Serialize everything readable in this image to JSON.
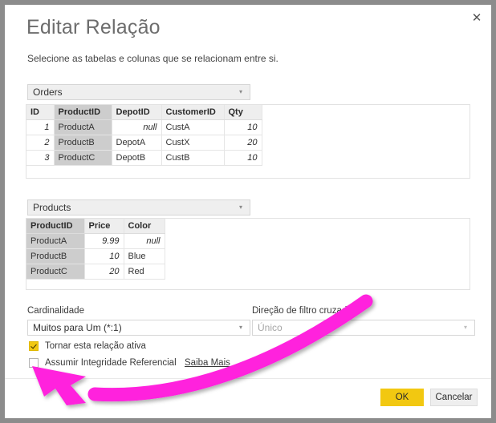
{
  "dialog": {
    "title": "Editar Relação",
    "subtitle": "Selecione as tabelas e colunas que se relacionam entre si.",
    "close_label": "✕"
  },
  "table_one": {
    "selector_value": "Orders",
    "selector_arrow": "▾",
    "selected_column": "ProductID",
    "columns": [
      "ID",
      "ProductID",
      "DepotID",
      "CustomerID",
      "Qty"
    ],
    "rows": [
      [
        "1",
        "ProductA",
        "null",
        "CustA",
        "10"
      ],
      [
        "2",
        "ProductB",
        "DepotA",
        "CustX",
        "20"
      ],
      [
        "3",
        "ProductC",
        "DepotB",
        "CustB",
        "10"
      ]
    ]
  },
  "table_two": {
    "selector_value": "Products",
    "selector_arrow": "▾",
    "selected_column": "ProductID",
    "columns": [
      "ProductID",
      "Price",
      "Color"
    ],
    "rows": [
      [
        "ProductA",
        "9.99",
        "null"
      ],
      [
        "ProductB",
        "10",
        "Blue"
      ],
      [
        "ProductC",
        "20",
        "Red"
      ]
    ]
  },
  "options": {
    "cardinality_label": "Cardinalidade",
    "cardinality_value": "Muitos para Um (*:1)",
    "cardinality_arrow": "▾",
    "crossfilter_label": "Direção de filtro cruzado",
    "crossfilter_value": "Único",
    "crossfilter_arrow": "▾",
    "active_relationship_label": "Tornar esta relação ativa",
    "active_relationship_checked": true,
    "referential_integrity_label": "Assumir Integridade Referencial",
    "referential_integrity_checked": false,
    "learn_more_label": "Saiba Mais"
  },
  "footer": {
    "ok_label": "OK",
    "cancel_label": "Cancelar"
  },
  "annotation": {
    "arrow_color": "#ff22dd",
    "description": "curved-magenta-arrow-pointing-to-referential-integrity-checkbox"
  },
  "colors": {
    "accent_yellow": "#f2c811",
    "window_border": "#8c8c8c",
    "selected_column": "#cdcdcd"
  }
}
